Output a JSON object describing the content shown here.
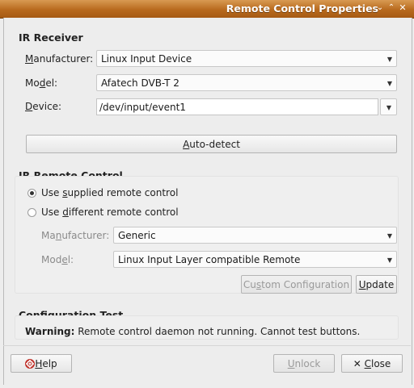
{
  "window": {
    "title": "Remote Control Properties"
  },
  "ir_receiver": {
    "heading": "IR Receiver",
    "manufacturer_label": "Manufacturer:",
    "manufacturer_value": "Linux Input Device",
    "model_label": "Model:",
    "model_value": "Afatech DVB-T 2",
    "device_label": "Device:",
    "device_value": "/dev/input/event1",
    "autodetect_label": "Auto-detect"
  },
  "ir_remote": {
    "heading": "IR Remote Control",
    "supplied_label": "Use supplied remote control",
    "supplied_checked": true,
    "different_label": "Use different remote control",
    "different_checked": false,
    "manufacturer_label": "Manufacturer:",
    "manufacturer_value": "Generic",
    "model_label": "Model:",
    "model_value": "Linux Input Layer compatible Remote",
    "custom_config_label": "Custom Configuration",
    "update_label": "Update"
  },
  "config_test": {
    "heading": "Configuration Test",
    "warning_prefix": "Warning:",
    "warning_text": "Remote control daemon not running. Cannot test buttons."
  },
  "footer": {
    "help_label": "Help",
    "unlock_label": "Unlock",
    "close_label": "Close"
  },
  "colors": {
    "titlebar": "#b86a1e",
    "background": "#ededed"
  }
}
